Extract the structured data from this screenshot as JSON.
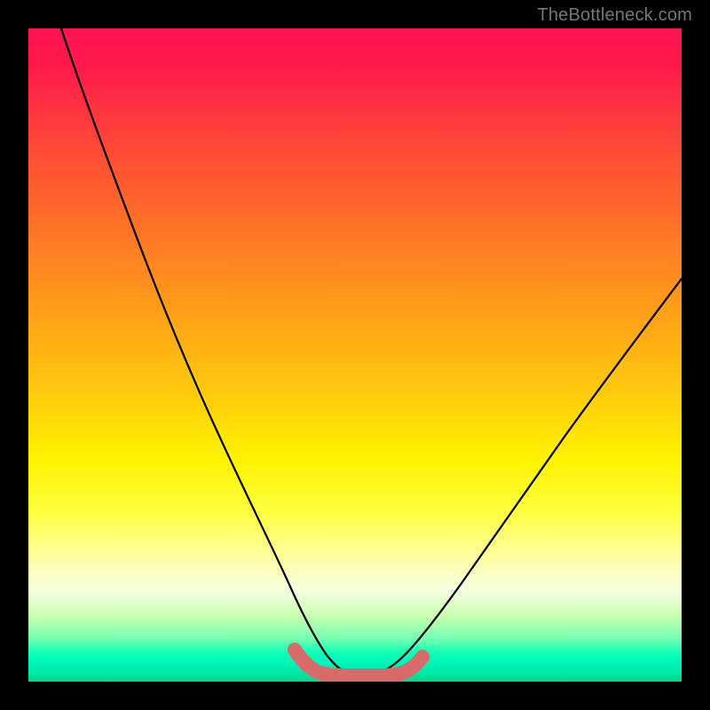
{
  "watermark": "TheBottleneck.com",
  "chart_data": {
    "type": "line",
    "title": "",
    "xlabel": "",
    "ylabel": "",
    "xlim": [
      0,
      100
    ],
    "ylim": [
      0,
      100
    ],
    "grid": false,
    "series": [
      {
        "name": "curve",
        "color": "#000000",
        "x": [
          5,
          10,
          15,
          20,
          25,
          30,
          35,
          38,
          40,
          42,
          44,
          46,
          48,
          50,
          52,
          55,
          60,
          65,
          70,
          75,
          80,
          85,
          90,
          95,
          100
        ],
        "y": [
          100,
          88,
          77,
          66,
          55,
          44,
          30,
          18,
          10,
          5,
          2,
          1,
          0.8,
          0.8,
          1,
          3,
          8,
          15,
          22,
          29,
          36,
          43,
          50,
          56,
          62
        ]
      }
    ],
    "band": {
      "name": "highlight",
      "color": "#d96a6a",
      "x": [
        40,
        42,
        44,
        46,
        48,
        50,
        52,
        54
      ],
      "y": [
        6,
        2.5,
        1.2,
        0.8,
        0.8,
        0.8,
        1.2,
        3
      ]
    },
    "bottom_stripes": [
      {
        "color": "#18f2b6"
      },
      {
        "color": "#00e6a0"
      },
      {
        "color": "#00d886"
      }
    ]
  }
}
